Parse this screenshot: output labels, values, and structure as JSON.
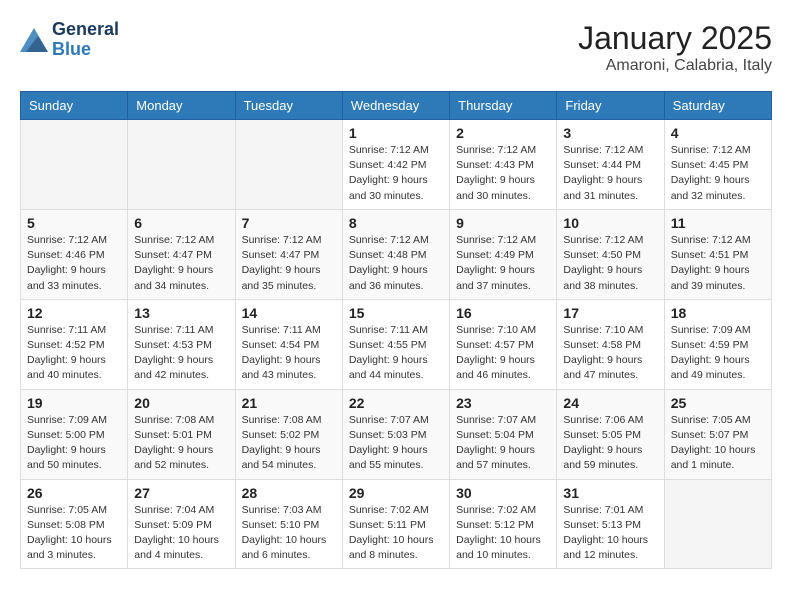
{
  "header": {
    "logo_line1": "General",
    "logo_line2": "Blue",
    "month_title": "January 2025",
    "location": "Amaroni, Calabria, Italy"
  },
  "days_of_week": [
    "Sunday",
    "Monday",
    "Tuesday",
    "Wednesday",
    "Thursday",
    "Friday",
    "Saturday"
  ],
  "weeks": [
    [
      {
        "day": "",
        "info": ""
      },
      {
        "day": "",
        "info": ""
      },
      {
        "day": "",
        "info": ""
      },
      {
        "day": "1",
        "info": "Sunrise: 7:12 AM\nSunset: 4:42 PM\nDaylight: 9 hours\nand 30 minutes."
      },
      {
        "day": "2",
        "info": "Sunrise: 7:12 AM\nSunset: 4:43 PM\nDaylight: 9 hours\nand 30 minutes."
      },
      {
        "day": "3",
        "info": "Sunrise: 7:12 AM\nSunset: 4:44 PM\nDaylight: 9 hours\nand 31 minutes."
      },
      {
        "day": "4",
        "info": "Sunrise: 7:12 AM\nSunset: 4:45 PM\nDaylight: 9 hours\nand 32 minutes."
      }
    ],
    [
      {
        "day": "5",
        "info": "Sunrise: 7:12 AM\nSunset: 4:46 PM\nDaylight: 9 hours\nand 33 minutes."
      },
      {
        "day": "6",
        "info": "Sunrise: 7:12 AM\nSunset: 4:47 PM\nDaylight: 9 hours\nand 34 minutes."
      },
      {
        "day": "7",
        "info": "Sunrise: 7:12 AM\nSunset: 4:47 PM\nDaylight: 9 hours\nand 35 minutes."
      },
      {
        "day": "8",
        "info": "Sunrise: 7:12 AM\nSunset: 4:48 PM\nDaylight: 9 hours\nand 36 minutes."
      },
      {
        "day": "9",
        "info": "Sunrise: 7:12 AM\nSunset: 4:49 PM\nDaylight: 9 hours\nand 37 minutes."
      },
      {
        "day": "10",
        "info": "Sunrise: 7:12 AM\nSunset: 4:50 PM\nDaylight: 9 hours\nand 38 minutes."
      },
      {
        "day": "11",
        "info": "Sunrise: 7:12 AM\nSunset: 4:51 PM\nDaylight: 9 hours\nand 39 minutes."
      }
    ],
    [
      {
        "day": "12",
        "info": "Sunrise: 7:11 AM\nSunset: 4:52 PM\nDaylight: 9 hours\nand 40 minutes."
      },
      {
        "day": "13",
        "info": "Sunrise: 7:11 AM\nSunset: 4:53 PM\nDaylight: 9 hours\nand 42 minutes."
      },
      {
        "day": "14",
        "info": "Sunrise: 7:11 AM\nSunset: 4:54 PM\nDaylight: 9 hours\nand 43 minutes."
      },
      {
        "day": "15",
        "info": "Sunrise: 7:11 AM\nSunset: 4:55 PM\nDaylight: 9 hours\nand 44 minutes."
      },
      {
        "day": "16",
        "info": "Sunrise: 7:10 AM\nSunset: 4:57 PM\nDaylight: 9 hours\nand 46 minutes."
      },
      {
        "day": "17",
        "info": "Sunrise: 7:10 AM\nSunset: 4:58 PM\nDaylight: 9 hours\nand 47 minutes."
      },
      {
        "day": "18",
        "info": "Sunrise: 7:09 AM\nSunset: 4:59 PM\nDaylight: 9 hours\nand 49 minutes."
      }
    ],
    [
      {
        "day": "19",
        "info": "Sunrise: 7:09 AM\nSunset: 5:00 PM\nDaylight: 9 hours\nand 50 minutes."
      },
      {
        "day": "20",
        "info": "Sunrise: 7:08 AM\nSunset: 5:01 PM\nDaylight: 9 hours\nand 52 minutes."
      },
      {
        "day": "21",
        "info": "Sunrise: 7:08 AM\nSunset: 5:02 PM\nDaylight: 9 hours\nand 54 minutes."
      },
      {
        "day": "22",
        "info": "Sunrise: 7:07 AM\nSunset: 5:03 PM\nDaylight: 9 hours\nand 55 minutes."
      },
      {
        "day": "23",
        "info": "Sunrise: 7:07 AM\nSunset: 5:04 PM\nDaylight: 9 hours\nand 57 minutes."
      },
      {
        "day": "24",
        "info": "Sunrise: 7:06 AM\nSunset: 5:05 PM\nDaylight: 9 hours\nand 59 minutes."
      },
      {
        "day": "25",
        "info": "Sunrise: 7:05 AM\nSunset: 5:07 PM\nDaylight: 10 hours\nand 1 minute."
      }
    ],
    [
      {
        "day": "26",
        "info": "Sunrise: 7:05 AM\nSunset: 5:08 PM\nDaylight: 10 hours\nand 3 minutes."
      },
      {
        "day": "27",
        "info": "Sunrise: 7:04 AM\nSunset: 5:09 PM\nDaylight: 10 hours\nand 4 minutes."
      },
      {
        "day": "28",
        "info": "Sunrise: 7:03 AM\nSunset: 5:10 PM\nDaylight: 10 hours\nand 6 minutes."
      },
      {
        "day": "29",
        "info": "Sunrise: 7:02 AM\nSunset: 5:11 PM\nDaylight: 10 hours\nand 8 minutes."
      },
      {
        "day": "30",
        "info": "Sunrise: 7:02 AM\nSunset: 5:12 PM\nDaylight: 10 hours\nand 10 minutes."
      },
      {
        "day": "31",
        "info": "Sunrise: 7:01 AM\nSunset: 5:13 PM\nDaylight: 10 hours\nand 12 minutes."
      },
      {
        "day": "",
        "info": ""
      }
    ]
  ]
}
